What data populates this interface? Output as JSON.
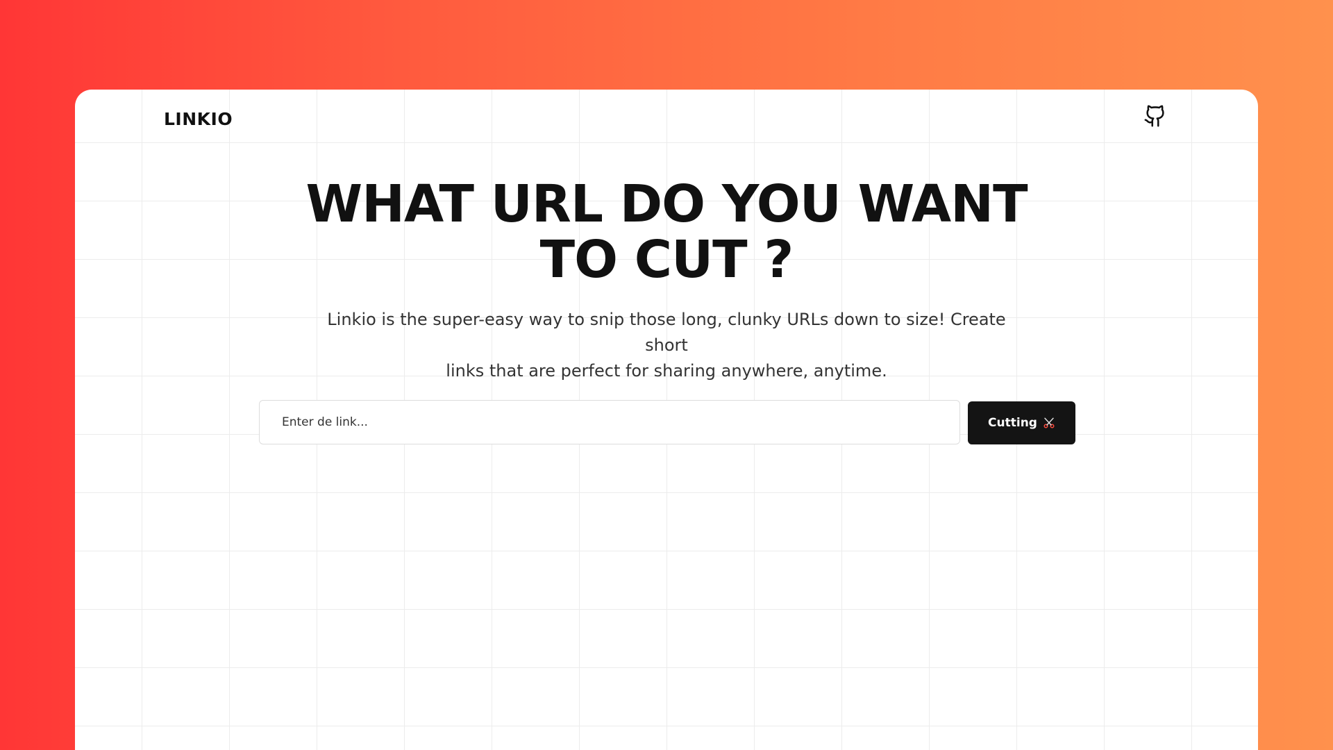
{
  "navbar": {
    "logo": "LINKIO",
    "github_icon": "github-icon"
  },
  "hero": {
    "title_line1": "WHAT URL DO YOU WANT",
    "title_line2": "TO CUT ?",
    "subtitle_line1": "Linkio is the super-easy way to snip those long, clunky URLs down to size! Create short",
    "subtitle_line2": "links that are perfect for sharing anywhere, anytime."
  },
  "form": {
    "input_placeholder": "Enter de link...",
    "input_value": "",
    "button_label": "Cutting",
    "button_icon": "scissors-icon"
  },
  "colors": {
    "gradient_start": "#ff3636",
    "gradient_end": "#ff914d",
    "button_bg": "#141414",
    "scissors_accent": "#ff4a3d"
  }
}
